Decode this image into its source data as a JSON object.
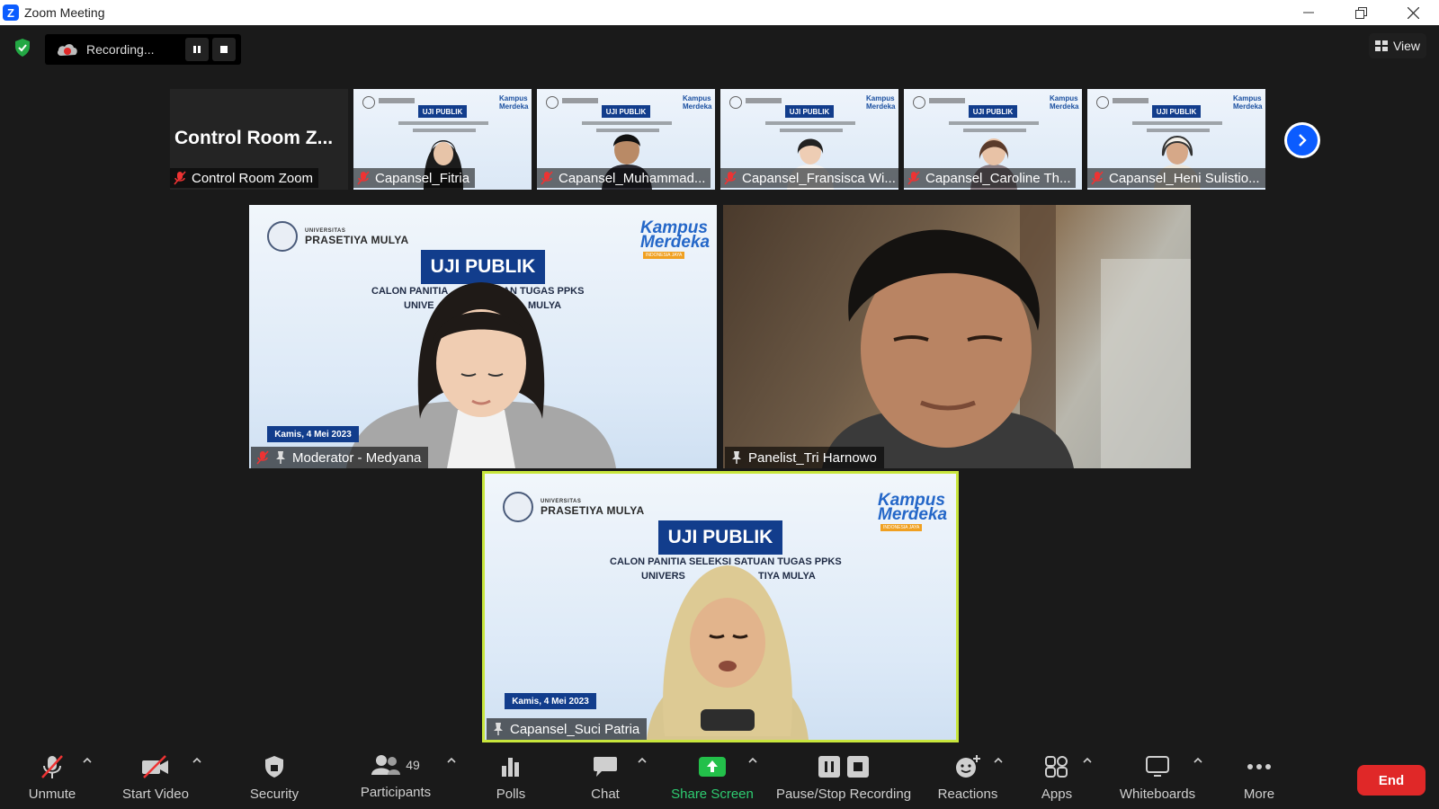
{
  "window": {
    "title": "Zoom Meeting"
  },
  "recording": {
    "label": "Recording..."
  },
  "view": {
    "label": "View"
  },
  "control_room": {
    "big_text": "Control Room Z...",
    "name": "Control Room Zoom"
  },
  "filmstrip": [
    {
      "name": "Capansel_Fitria"
    },
    {
      "name": "Capansel_Muhammad..."
    },
    {
      "name": "Capansel_Fransisca Wi..."
    },
    {
      "name": "Capansel_Caroline Th..."
    },
    {
      "name": "Capansel_Heni Sulistio..."
    }
  ],
  "slide": {
    "uni_small": "UNIVERSITAS",
    "uni": "PRASETIYA MULYA",
    "brand": "Kampus Merdeka",
    "brand_sub": "INDONESIA JAYA",
    "title": "UJI PUBLIK",
    "line1": "CALON PANITIA SELEKSI SATUAN TUGAS PPKS",
    "line2": "UNIVERSITAS PRASETIYA MULYA",
    "date": "Kamis, 4 Mei 2023",
    "mini_title": "UJI PUBLIK",
    "mini_brand": "Kampus Merdeka"
  },
  "moderator": {
    "name": "Moderator - Medyana",
    "line1": "CALON PANITIA",
    "line1b": "AN TUGAS PPKS",
    "line2": "UNIVE",
    "line2b": "MULYA"
  },
  "panelist": {
    "name": "Panelist_Tri Harnowo"
  },
  "speaker": {
    "name": "Capansel_Suci Patria",
    "line2": "UNIVERS",
    "line2b": "TIYA MULYA"
  },
  "toolbar": {
    "unmute": "Unmute",
    "start_video": "Start Video",
    "security": "Security",
    "participants": "Participants",
    "participants_count": "49",
    "polls": "Polls",
    "chat": "Chat",
    "share_screen": "Share Screen",
    "pause_stop_recording": "Pause/Stop Recording",
    "reactions": "Reactions",
    "apps": "Apps",
    "whiteboards": "Whiteboards",
    "more": "More",
    "end": "End"
  },
  "colors": {
    "zoom_blue": "#0b5cff",
    "end_red": "#e02828",
    "share_green": "#2ecc71",
    "active_speaker_border": "#c8e63c",
    "slide_navy": "#123d8c"
  }
}
